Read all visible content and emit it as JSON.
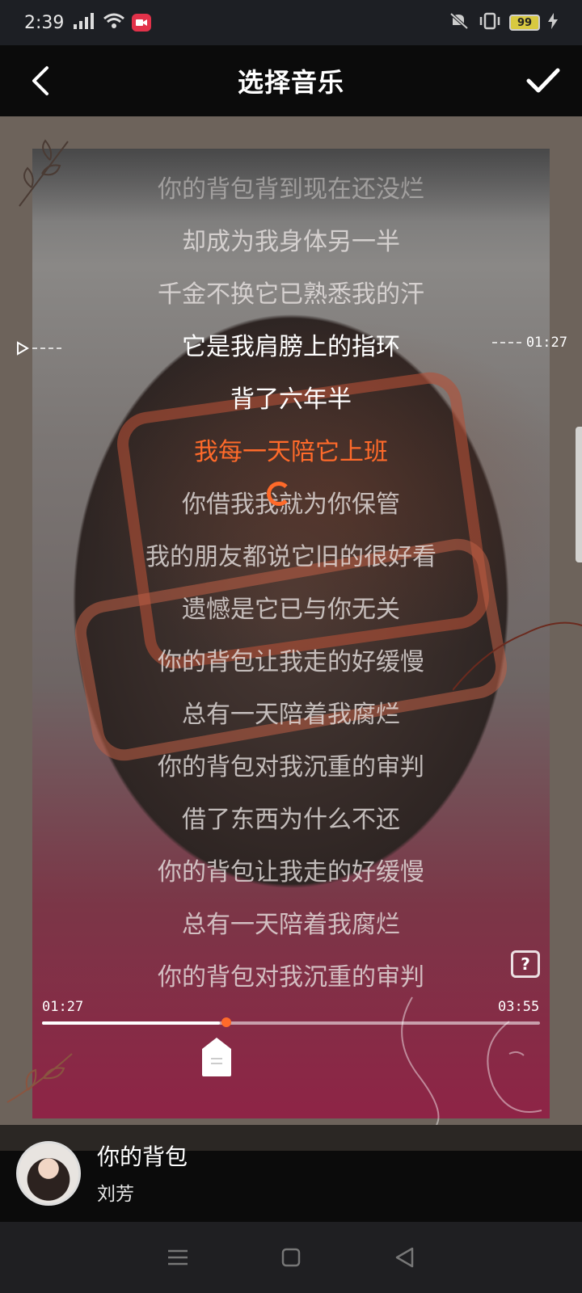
{
  "status": {
    "time": "2:39",
    "battery": "99"
  },
  "header": {
    "title": "选择音乐"
  },
  "lyrics": [
    "你的背包背到现在还没烂",
    "却成为我身体另一半",
    "千金不换它已熟悉我的汗",
    "它是我肩膀上的指环",
    "背了六年半",
    "我每一天陪它上班",
    "你借我我就为你保管",
    "我的朋友都说它旧的很好看",
    "遗憾是它已与你无关",
    "你的背包让我走的好缓慢",
    "总有一天陪着我腐烂",
    "你的背包对我沉重的审判",
    "借了东西为什么不还",
    "你的背包让我走的好缓慢",
    "总有一天陪着我腐烂",
    "你的背包对我沉重的审判"
  ],
  "marker_time": "01:27",
  "player": {
    "current_time": "01:27",
    "total_time": "03:55",
    "progress": 0.37,
    "help_label": "?"
  },
  "song": {
    "title": "你的背包",
    "artist": "刘芳"
  },
  "colors": {
    "accent": "#ff6a2a"
  }
}
